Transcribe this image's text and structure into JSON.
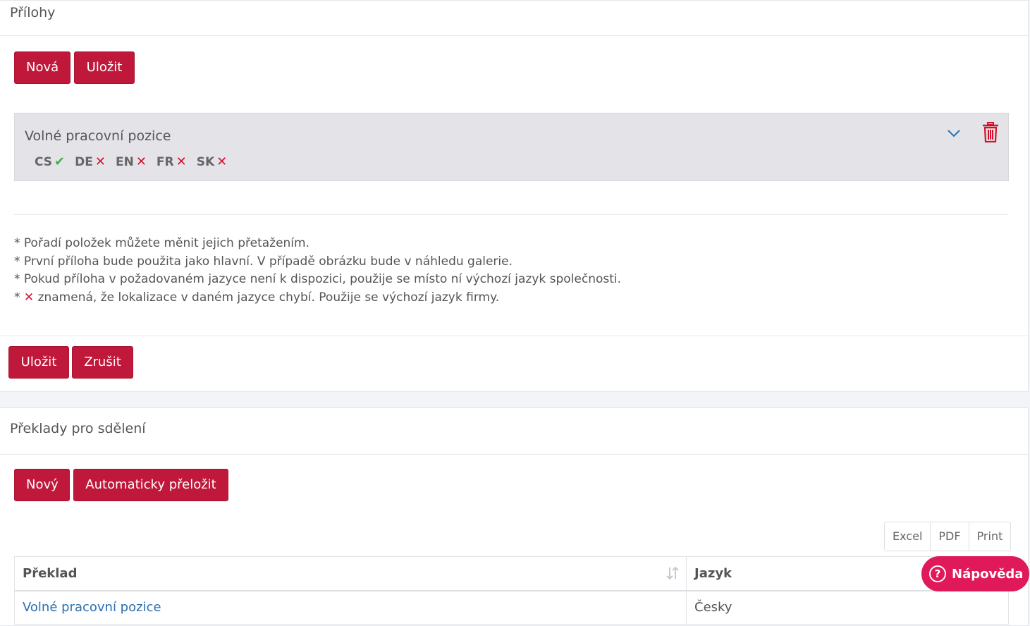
{
  "attachments": {
    "title": "Přílohy",
    "new_label": "Nová",
    "save_label": "Uložit",
    "item": {
      "title": "Volné pracovní pozice",
      "langs": [
        {
          "code": "CS",
          "status": "✔"
        },
        {
          "code": "DE",
          "status": "✕"
        },
        {
          "code": "EN",
          "status": "✕"
        },
        {
          "code": "FR",
          "status": "✕"
        },
        {
          "code": "SK",
          "status": "✕"
        }
      ]
    },
    "notes": {
      "star": "*",
      "note1": "* Pořadí položek můžete měnit jejich přetažením.",
      "note2": "* První příloha bude použita jako hlavní. V případě obrázku bude v náhledu galerie.",
      "note3": "* Pokud příloha v požadovaném jazyce není k dispozici, použije se místo ní výchozí jazyk společnosti.",
      "note4_mark": "✕",
      "note4": "znamená, že lokalizace v daném jazyce chybí. Použije se výchozí jazyk firmy."
    },
    "footer_save": "Uložit",
    "footer_cancel": "Zrušit"
  },
  "translations": {
    "title": "Překlady pro sdělení",
    "new_label": "Nový",
    "auto_label": "Automaticky přeložit",
    "export": {
      "excel": "Excel",
      "pdf": "PDF",
      "print": "Print"
    },
    "columns": {
      "translation": "Překlad",
      "language": "Jazyk"
    },
    "rows": [
      {
        "translation": "Volné pracovní pozice",
        "language": "Česky"
      }
    ]
  },
  "help": {
    "label": "Nápověda",
    "icon": "?"
  },
  "colors": {
    "primary": "#c0183a",
    "help": "#e0195b",
    "ok": "#3fb34f",
    "missing": "#d4122f",
    "link": "#2a6fb0"
  }
}
